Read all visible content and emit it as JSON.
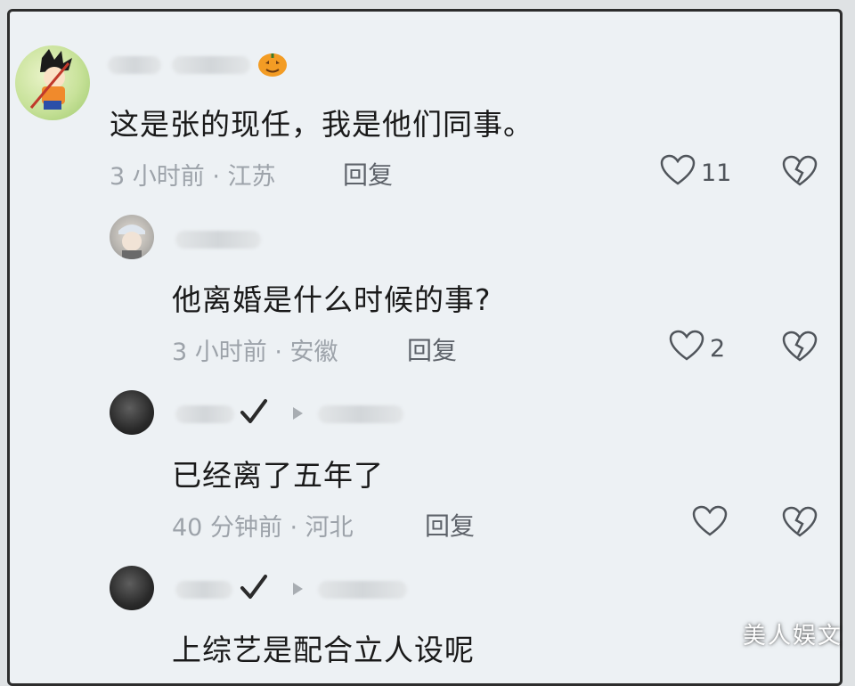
{
  "comments": [
    {
      "text": "这是张的现任，我是他们同事。",
      "meta": "3 小时前 · 江苏",
      "reply_label": "回复",
      "likes": "11"
    },
    {
      "text": "他离婚是什么时候的事?",
      "meta": "3 小时前 · 安徽",
      "reply_label": "回复",
      "likes": "2"
    },
    {
      "text": "已经离了五年了",
      "meta": "40 分钟前 · 河北",
      "reply_label": "回复",
      "likes": ""
    },
    {
      "text": "上综艺是配合立人设呢"
    }
  ],
  "badges": {
    "main_user_badge": "pumpkin-icon"
  },
  "watermark": "美人娱文",
  "colors": {
    "text": "#1a1a1a",
    "meta": "#9da3aa",
    "background": "#edf1f4"
  }
}
